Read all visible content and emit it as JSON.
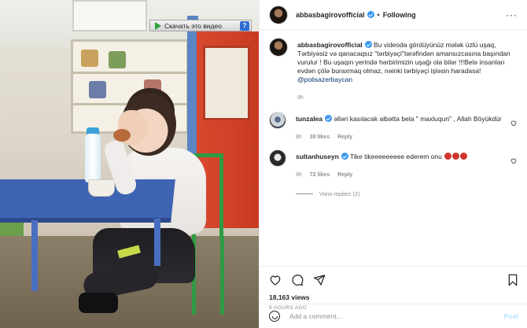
{
  "video": {
    "download_label": "Скачать это видео",
    "help_label": "?"
  },
  "header": {
    "username": "abbasbagirovofficial",
    "separator": "•",
    "follow_status": "Following",
    "more_label": "···"
  },
  "caption": {
    "username": "abbasbagirovofficial",
    "text": "Bu videoda gördüyünüz mələk üzlü uşaq, Tərbiyəsiz və qanacaqsız \"tərbiyəçi\"tərəfindən amansızcasına başından vurulur ! Bu uşaqın yerində hərbirimizin uşağı ola bilər !!!Belə insanları evdən çölə buraxmaq olmaz, nəinki tərbiyəçi işləsin haradasa!",
    "mention": "@polisazerbaycan",
    "time": "9h"
  },
  "comments": [
    {
      "username": "tunzalea",
      "text": "əlləri kasılacak albətta bela \" maxluqun\" , Allah Böyükdür",
      "time": "8h",
      "likes": "30 likes",
      "reply": "Reply"
    },
    {
      "username": "sultanhuseyn",
      "text": "Tike tikeeeeeeeee ederem onu",
      "time": "9h",
      "likes": "72 likes",
      "reply": "Reply",
      "emoji_count": 3
    }
  ],
  "view_replies": "View replies (2)",
  "stats": {
    "views": "18,163 views",
    "posted": "9 HOURS AGO"
  },
  "add_comment": {
    "placeholder": "Add a comment...",
    "post_label": "Post"
  },
  "colors": {
    "link": "#00376b",
    "muted": "#8e8e8e",
    "verified": "#3897f0",
    "post_disabled": "#b2dffc"
  }
}
